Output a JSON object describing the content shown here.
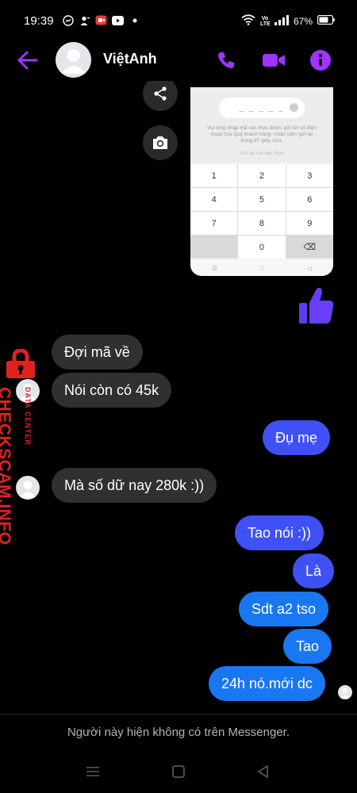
{
  "status_bar": {
    "time": "19:39",
    "network_label": "Vo LTE",
    "battery": "67%"
  },
  "header": {
    "contact_name": "ViệtAnh",
    "accent_color": "#a033ff"
  },
  "shared_image": {
    "otp_placeholder": "_ _ _ _ _",
    "caption": "Vui lòng nhập mã xác thực được gửi tới số điện thoại của Quý khách hàng. Hoặc bấm gửi lại trong 67 giây nữa.",
    "resend": "Gửi lại mã xác thực",
    "keys": [
      "1",
      "2",
      "3",
      "4",
      "5",
      "6",
      "7",
      "8",
      "9",
      "",
      "0",
      "⌫"
    ]
  },
  "messages": [
    {
      "side": "received",
      "text": "Đợi mã về"
    },
    {
      "side": "received",
      "text": "Nói còn có 45k"
    },
    {
      "side": "sent",
      "text": "Đụ mẹ"
    },
    {
      "side": "received",
      "text": "Mà số dữ nay 280k :))"
    },
    {
      "side": "sent",
      "text": "Tao nói  :))"
    },
    {
      "side": "sent",
      "text": "Là"
    },
    {
      "side": "sent",
      "text": "Sdt a2 tso"
    },
    {
      "side": "sent",
      "text": "Tao"
    },
    {
      "side": "sent",
      "text": "24h nó.mới dc"
    }
  ],
  "watermark": {
    "main": "CHECKSCAM.INFO",
    "sub": "DATA CENTER"
  },
  "footer": {
    "note": "Người này hiện không có trên Messenger."
  },
  "colors": {
    "sent_purple": "#3f51f5",
    "sent_blue": "#1a77f2",
    "received": "#303030",
    "watermark_red": "#e0221f"
  }
}
